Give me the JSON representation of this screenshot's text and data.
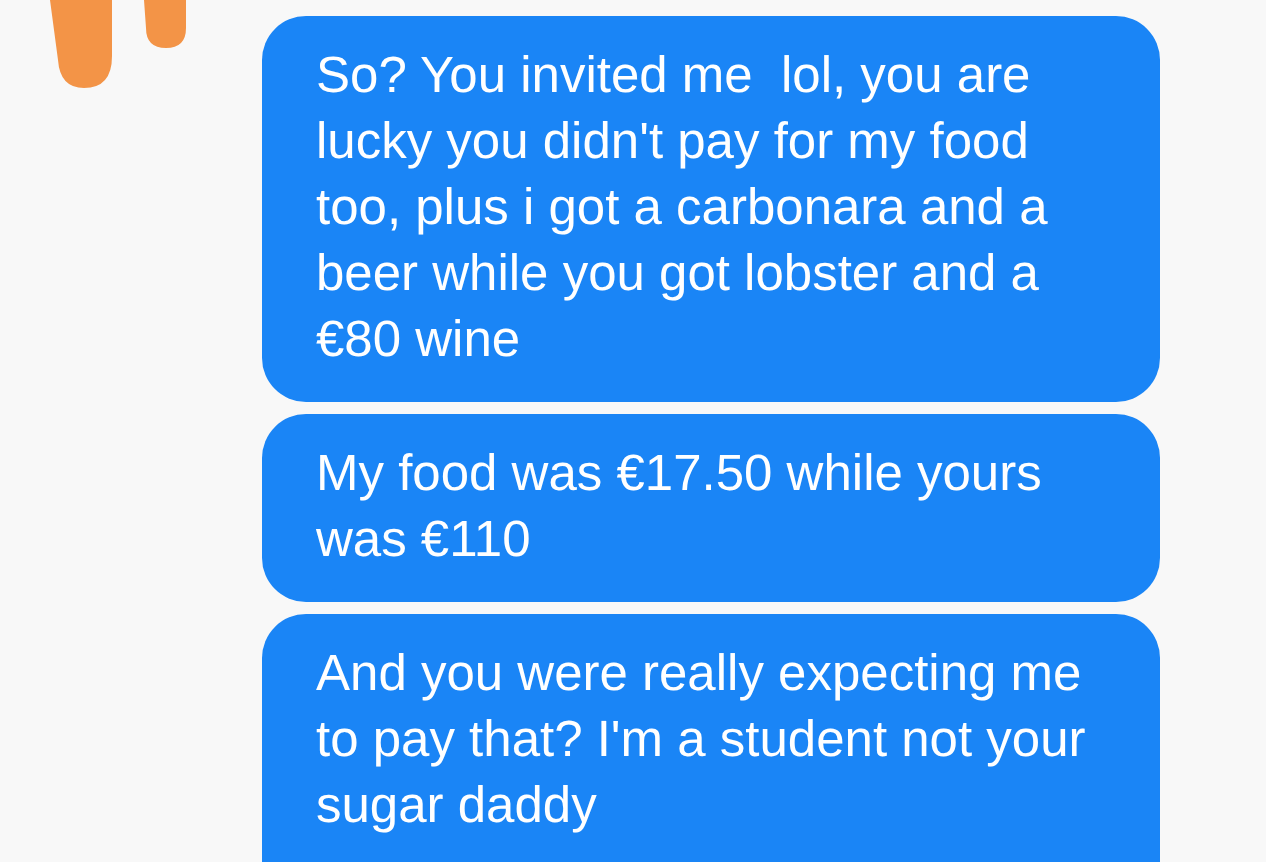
{
  "messages": [
    {
      "text": "So? You invited me  lol, you are lucky you didn't pay for my food too, plus i got a carbonara and a beer while you got lobster and a €80 wine"
    },
    {
      "text": "My food was €17.50 while yours was €110"
    },
    {
      "text": "And you were really expecting me to pay that? I'm a student not your sugar daddy"
    }
  ]
}
